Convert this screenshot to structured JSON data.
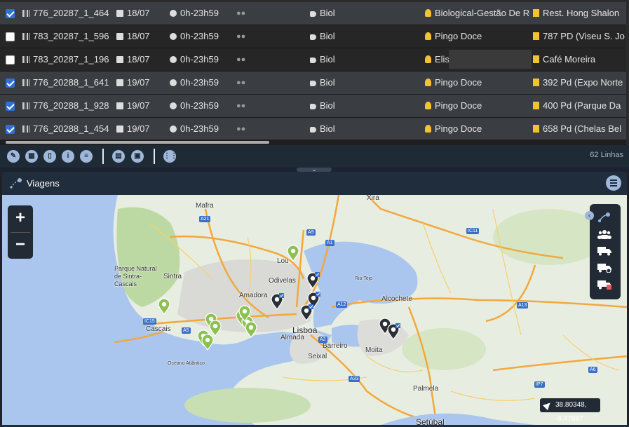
{
  "table": {
    "rows": [
      {
        "selected": true,
        "code": "776_20287_1_464",
        "date": "18/07",
        "time": "0h-23h59",
        "tag": "Biol",
        "client": "Biological-Gestão De Re",
        "site": "Rest. Hong Shalon"
      },
      {
        "selected": false,
        "code": "783_20287_1_596",
        "date": "18/07",
        "time": "0h-23h59",
        "tag": "Biol",
        "client": "Pingo Doce",
        "site": "787 PD (Viseu S. Jo"
      },
      {
        "selected": false,
        "code": "783_20287_1_196",
        "date": "18/07",
        "time": "0h-23h59",
        "tag": "Biol",
        "client": "Elis",
        "site": "Café Moreira"
      },
      {
        "selected": true,
        "code": "776_20288_1_641",
        "date": "19/07",
        "time": "0h-23h59",
        "tag": "Biol",
        "client": "Pingo Doce",
        "site": "392 Pd (Expo Norte"
      },
      {
        "selected": true,
        "code": "776_20288_1_928",
        "date": "19/07",
        "time": "0h-23h59",
        "tag": "Biol",
        "client": "Pingo Doce",
        "site": "400 Pd (Parque Da"
      },
      {
        "selected": true,
        "code": "776_20288_1_454",
        "date": "19/07",
        "time": "0h-23h59",
        "tag": "Biol",
        "client": "Pingo Doce",
        "site": "658 Pd (Chelas Bel"
      }
    ]
  },
  "toolbar": {
    "buttons": [
      "edit-icon",
      "calendar-icon",
      "trash-icon",
      "info-icon",
      "chat-icon",
      "document-icon",
      "image-icon",
      "grid-icon"
    ],
    "row_count": "62 Linhas"
  },
  "panel": {
    "title": "Viagens"
  },
  "map": {
    "zoom_in": "+",
    "zoom_out": "−",
    "coords": "38.80348, -9.47867",
    "labels": {
      "mafra": "Mafra",
      "xira": "Xira",
      "sintra_park": "Parque Natural",
      "sintra_park2": "de Sintra-",
      "sintra_park3": "Cascais",
      "sintra": "Sintra",
      "odivelas": "Odivelas",
      "amadora": "Amadora",
      "lisboa": "Lisboa",
      "almada": "Almada",
      "barreiro": "Barreiro",
      "seixal": "Seixal",
      "moita": "Moita",
      "alcochete": "Alcochete",
      "rio_tejo": "Rio Tejo",
      "cascais": "Cascais",
      "oceano": "Oceano Atlântico",
      "palmela": "Palmela",
      "setubal": "Setúbal",
      "loures": "Lou"
    },
    "roads": [
      "A21",
      "A9",
      "A1",
      "IC11",
      "A12",
      "A13",
      "A5",
      "IC15",
      "A2",
      "A33",
      "A6",
      "IP7"
    ]
  },
  "colors": {
    "pin_green": "#8cc152",
    "pin_dark": "#2b2f36",
    "accent": "#2f6fd6"
  }
}
